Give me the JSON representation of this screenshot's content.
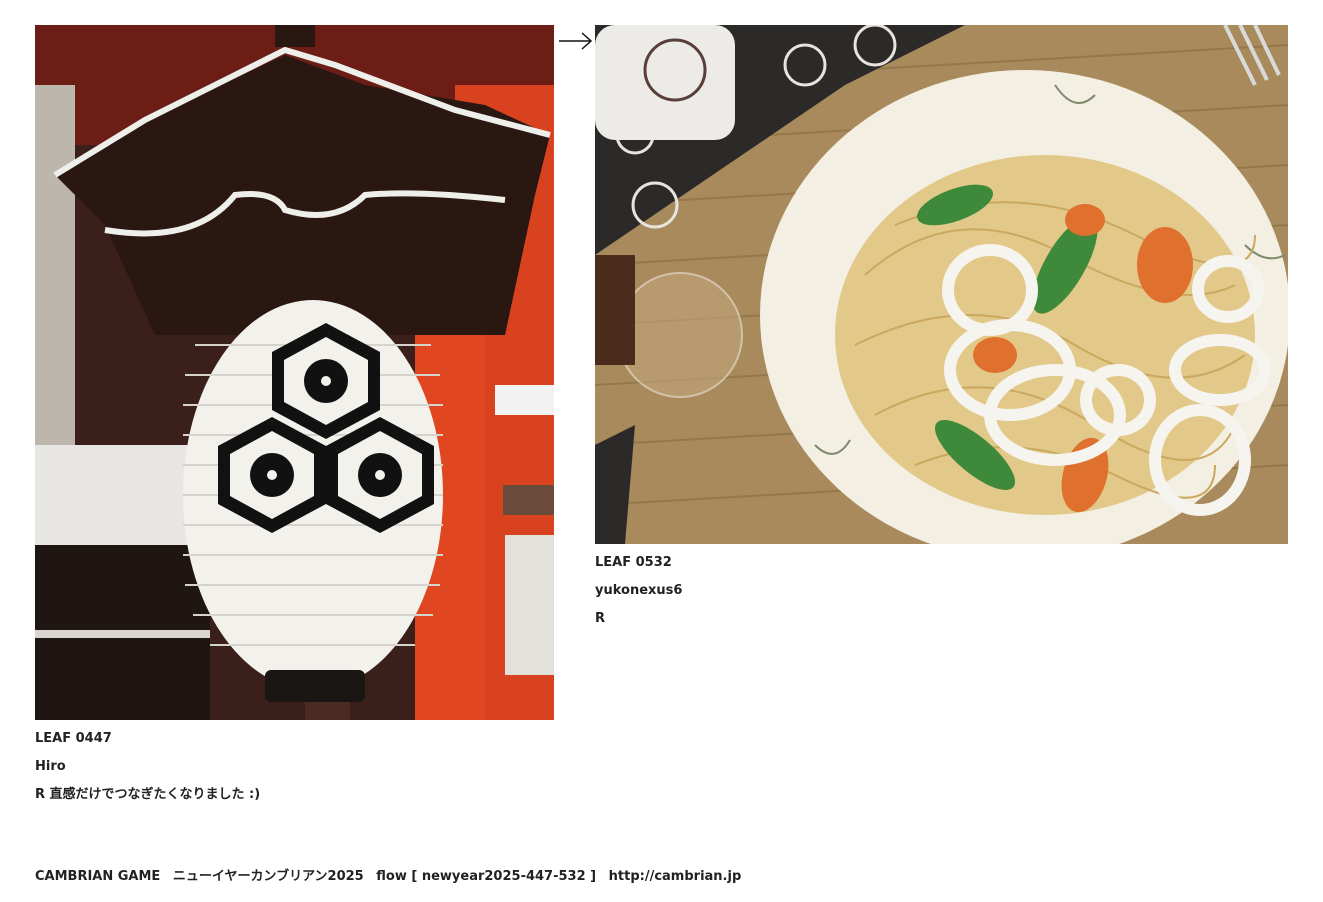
{
  "leaves": [
    {
      "number": "LEAF 0447",
      "author": "Hiro",
      "comment": "R 直感だけでつなぎたくなりました :)"
    },
    {
      "number": "LEAF 0532",
      "author": "yukonexus6",
      "comment": "R"
    }
  ],
  "footer": {
    "game": "CAMBRIAN GAME",
    "event": "ニューイヤーカンブリアン2025",
    "flow": "flow [ newyear2025-447-532 ]",
    "url": "http://cambrian.jp"
  },
  "arrow_icon": "right-arrow-icon"
}
